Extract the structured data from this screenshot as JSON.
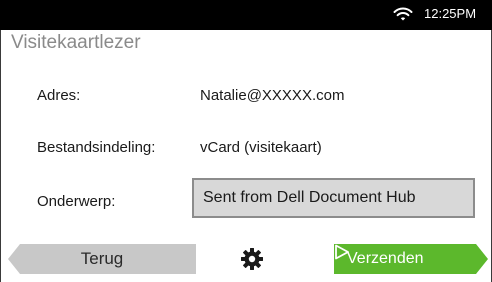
{
  "status_bar": {
    "wifi_icon": "wifi-icon",
    "time": "12:25PM"
  },
  "app": {
    "title": "Visitekaartlezer"
  },
  "fields": [
    {
      "label": "Adres:",
      "value": "Natalie@XXXXX.com"
    },
    {
      "label": "Bestandsindeling:",
      "value": "vCard (visitekaart)"
    },
    {
      "label": "Onderwerp:",
      "value": "Sent from Dell Document Hub"
    }
  ],
  "footer": {
    "back_label": "Terug",
    "settings_icon": "gear-icon",
    "send_label": "Verzenden",
    "send_icon": "play-icon"
  },
  "colors": {
    "status_bar": "#000000",
    "send_button": "#5cb82c",
    "back_button": "#c8c8c8",
    "subject_field": "#d8d8d8",
    "title_text": "#8a8a8a"
  }
}
